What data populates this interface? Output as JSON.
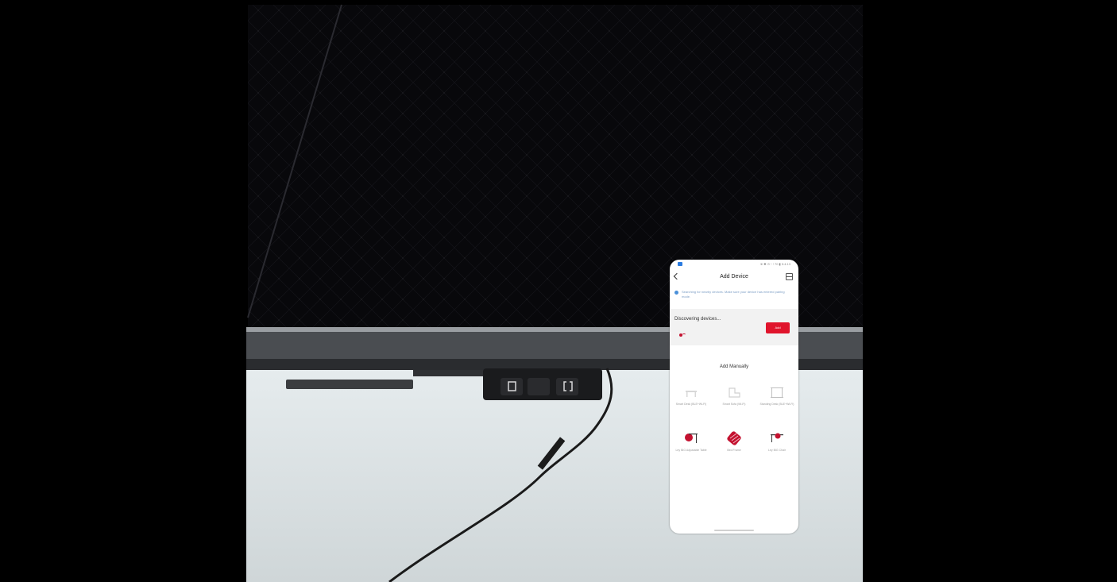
{
  "screen": {
    "status_bar": {
      "right_text": "※ ✱ ⊙ ⁝ ⁝ 70 ▮ 5:4:13"
    },
    "header": {
      "title": "Add Device"
    },
    "notice": {
      "text": "Searching for nearby devices. Make sure your device has entered pairing mode."
    },
    "discover": {
      "label": "Discovering devices...",
      "add_button": "Add"
    },
    "manual": {
      "title": "Add Manually",
      "items": [
        {
          "label": "Smart Desk (BLE+Wi-Fi)",
          "icon": "desk-icon",
          "color": "#d8d8d8"
        },
        {
          "label": "Smart Sofa (Wi-Fi)",
          "icon": "sofa-icon",
          "color": "#d8d8d8"
        },
        {
          "label": "Standing Desk (BLE+Wi-Fi)",
          "icon": "standing-desk-icon",
          "color": "#bfbfbf"
        },
        {
          "label": "Ley BIG Adjustable Table",
          "icon": "adjustable-table-icon",
          "color": "#c41230"
        },
        {
          "label": "Bed Frame",
          "icon": "bed-frame-icon",
          "color": "#c41230"
        },
        {
          "label": "Ley BIG Chair",
          "icon": "chair-table-icon",
          "color": "#c41230"
        }
      ]
    }
  },
  "colors": {
    "accent": "#e0142c",
    "brand_red": "#c41230",
    "link": "#7a9cc4"
  }
}
